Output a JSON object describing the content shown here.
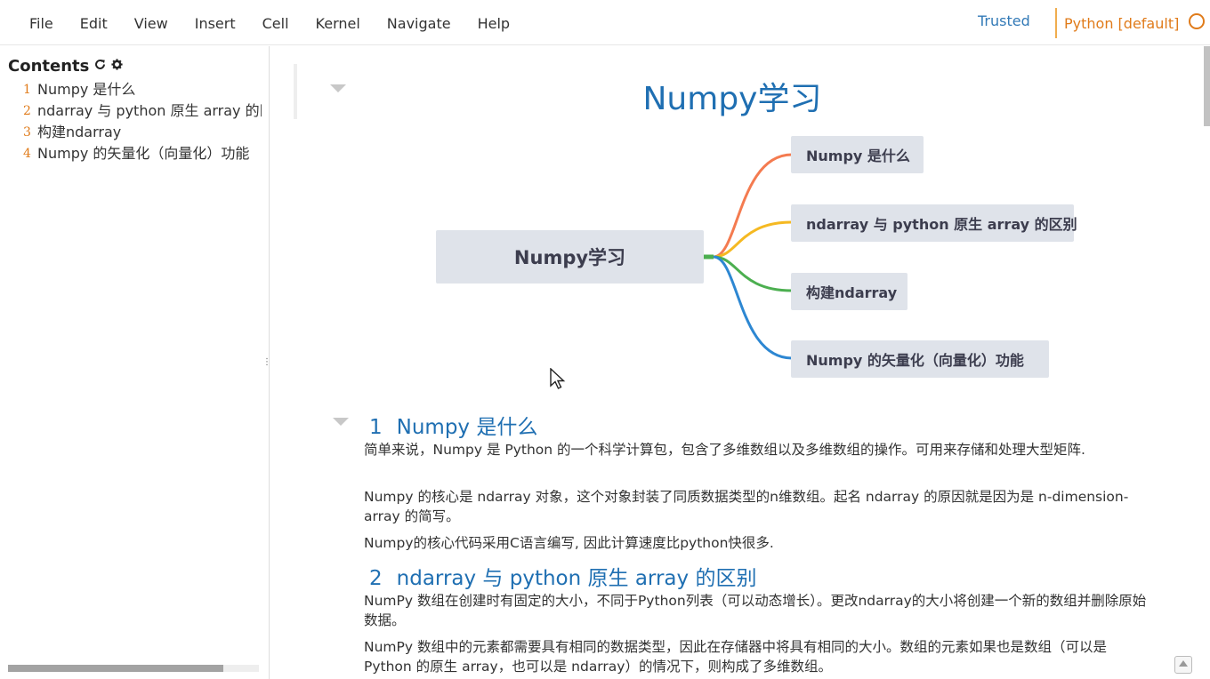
{
  "menu": {
    "items": [
      "File",
      "Edit",
      "View",
      "Insert",
      "Cell",
      "Kernel",
      "Navigate",
      "Help"
    ],
    "trusted": "Trusted",
    "kernel": "Python [default]"
  },
  "toc": {
    "title": "Contents",
    "items": [
      {
        "num": "1",
        "label": "Numpy 是什么"
      },
      {
        "num": "2",
        "label": "ndarray 与 python 原生 array 的区别"
      },
      {
        "num": "3",
        "label": "构建ndarray"
      },
      {
        "num": "4",
        "label": "Numpy 的矢量化（向量化）功能"
      }
    ]
  },
  "notebook": {
    "title": "Numpy学习",
    "mindmap": {
      "root": "Numpy学习",
      "branches": [
        {
          "label": "Numpy 是什么",
          "color": "#f47b50"
        },
        {
          "label": "ndarray 与 python 原生 array 的区别",
          "color": "#f5b922"
        },
        {
          "label": "构建ndarray",
          "color": "#4caf50"
        },
        {
          "label": "Numpy 的矢量化（向量化）功能",
          "color": "#2d87d2"
        }
      ]
    },
    "section1": {
      "num": "1",
      "title": "Numpy 是什么",
      "paragraphs": [
        "简单来说，Numpy 是 Python 的一个科学计算包，包含了多维数组以及多维数组的操作。可用来存储和处理大型矩阵.",
        "Numpy 的核心是 ndarray 对象，这个对象封装了同质数据类型的n维数组。起名 ndarray 的原因就是因为是 n-dimension-array 的简写。",
        "Numpy的核心代码采用C语言编写, 因此计算速度比python快很多."
      ]
    },
    "section2": {
      "num": "2",
      "title": "ndarray 与 python 原生 array 的区别",
      "paragraphs": [
        "NumPy 数组在创建时有固定的大小，不同于Python列表（可以动态增长）。更改ndarray的大小将创建一个新的数组并删除原始数据。",
        "NumPy 数组中的元素都需要具有相同的数据类型，因此在存储器中将具有相同的大小。数组的元素如果也是数组（可以是 Python 的原生 array，也可以是 ndarray）的情况下，则构成了多维数组。"
      ]
    }
  }
}
